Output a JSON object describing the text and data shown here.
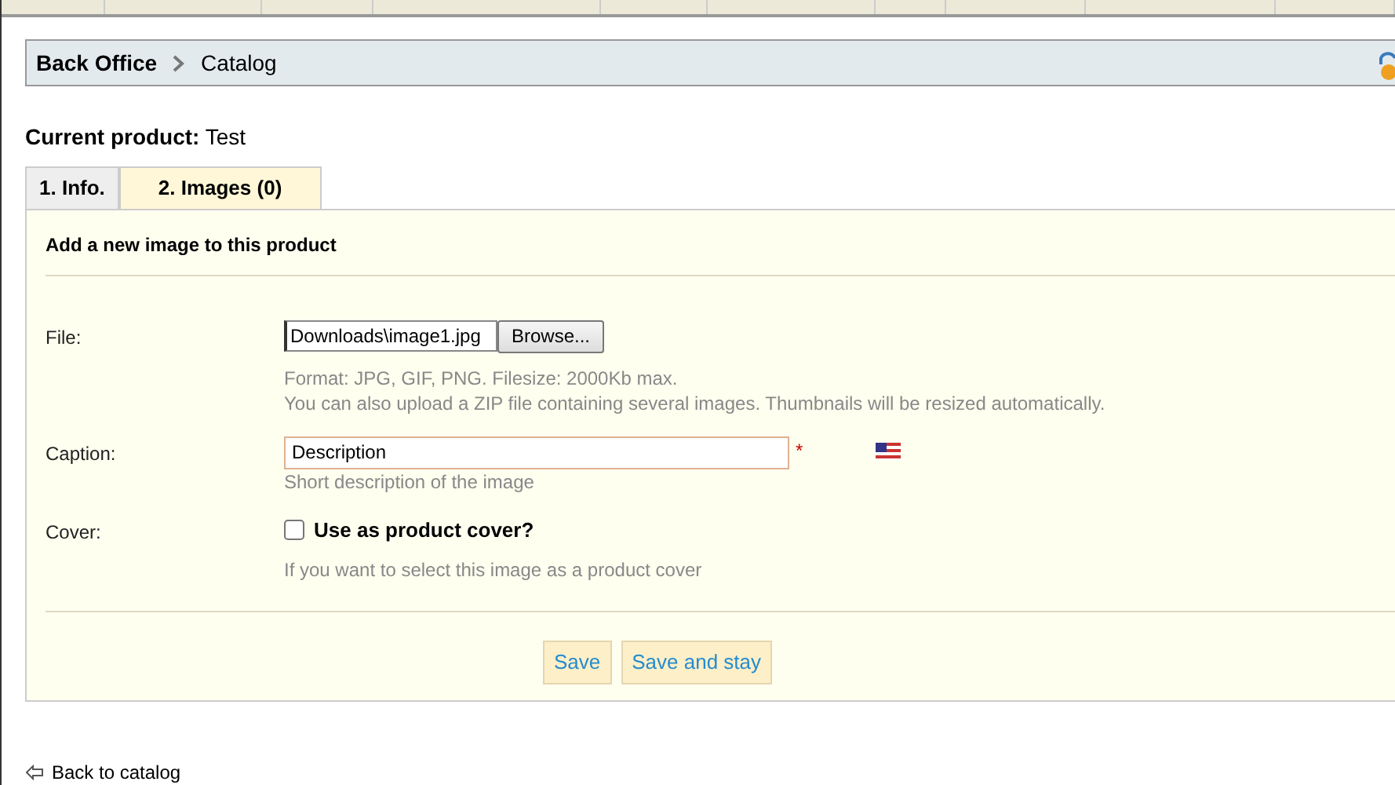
{
  "breadcrumb": [
    {
      "label": "Back Office",
      "kind": "root"
    },
    {
      "label": "Catalog",
      "kind": "page"
    }
  ],
  "current_product": {
    "label": "Current product:",
    "value": "Test"
  },
  "tabs": [
    {
      "label": "1. Info.",
      "selected": false
    },
    {
      "label": "2. Images (0)",
      "selected": true
    }
  ],
  "panel": {
    "title": "Add a new image to this product",
    "file": {
      "label": "File:",
      "value": "Downloads\\image1.jpg",
      "button": "Browse...",
      "hints": [
        "Format: JPG, GIF, PNG. Filesize: 2000Kb max.",
        "You can also upload a ZIP file containing several images. Thumbnails will be resized automatically."
      ]
    },
    "caption": {
      "label": "Caption:",
      "value": "Description",
      "required": "*",
      "hint": "Short description of the image"
    },
    "cover": {
      "label": "Cover:",
      "checkbox_label": "Use as product cover?",
      "checked": false,
      "hint": "If you want to select this image as a product cover"
    },
    "buttons": [
      "Save",
      "Save and stay"
    ]
  },
  "back_link": "Back to catalog"
}
